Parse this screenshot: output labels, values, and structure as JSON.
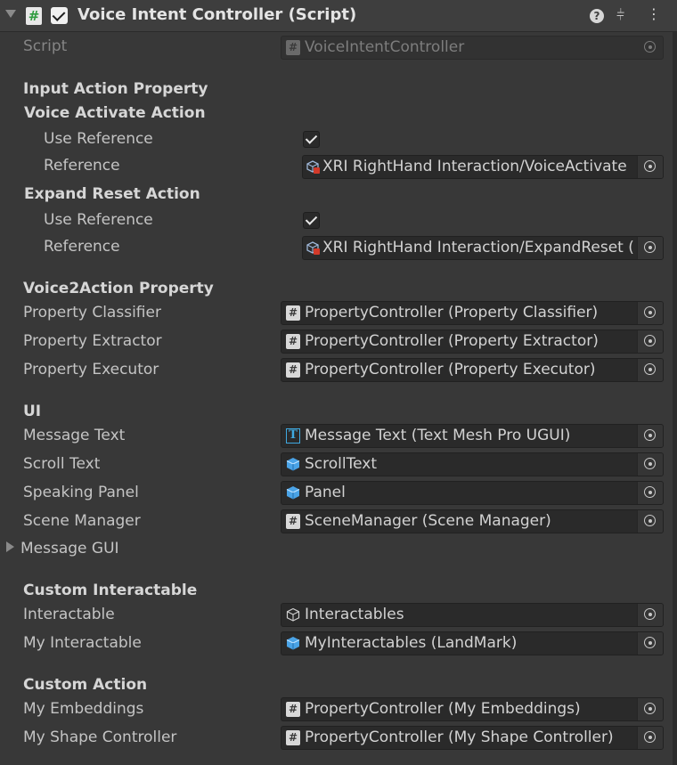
{
  "header": {
    "title": "Voice Intent Controller (Script)",
    "script_icon": "#",
    "help_icon": "?",
    "presets_icon": "⫩",
    "menu_icon": "⋮"
  },
  "script_row": {
    "label": "Script",
    "value": "VoiceIntentController",
    "icon": "#"
  },
  "input_action_property": {
    "header": "Input Action Property",
    "voice_activate": {
      "header": "Voice Activate Action",
      "use_reference_label": "Use Reference",
      "use_reference_checked": true,
      "reference_label": "Reference",
      "reference_value": "XRI RightHand Interaction/VoiceActivate"
    },
    "expand_reset": {
      "header": "Expand Reset Action",
      "use_reference_label": "Use Reference",
      "use_reference_checked": true,
      "reference_label": "Reference",
      "reference_value": "XRI RightHand Interaction/ExpandReset ("
    }
  },
  "voice2action_property": {
    "header": "Voice2Action Property",
    "rows": [
      {
        "label": "Property Classifier",
        "value": "PropertyController (Property Classifier)",
        "icon": "#"
      },
      {
        "label": "Property Extractor",
        "value": "PropertyController (Property Extractor)",
        "icon": "#"
      },
      {
        "label": "Property Executor",
        "value": "PropertyController (Property Executor)",
        "icon": "#"
      }
    ]
  },
  "ui": {
    "header": "UI",
    "rows": [
      {
        "label": "Message Text",
        "value": "Message Text (Text Mesh Pro UGUI)",
        "icon": "T"
      },
      {
        "label": "Scroll Text",
        "value": "ScrollText"
      },
      {
        "label": "Speaking Panel",
        "value": "Panel"
      },
      {
        "label": "Scene Manager",
        "value": "SceneManager (Scene Manager)",
        "icon": "#"
      }
    ],
    "message_gui_label": "Message GUI"
  },
  "custom_interactable": {
    "header": "Custom Interactable",
    "rows": [
      {
        "label": "Interactable",
        "value": "Interactables"
      },
      {
        "label": "My Interactable",
        "value": "MyInteractables (LandMark)"
      }
    ]
  },
  "custom_action": {
    "header": "Custom Action",
    "rows": [
      {
        "label": "My Embeddings",
        "value": "PropertyController (My Embeddings)",
        "icon": "#"
      },
      {
        "label": "My Shape Controller",
        "value": "PropertyController (My Shape Controller)",
        "icon": "#"
      }
    ]
  },
  "colors": {
    "background": "#383838",
    "field_bg": "#2a2a2a",
    "text": "#c4c4c4",
    "accent_blue": "#3fa9e0",
    "script_green": "#2e9c3e"
  }
}
